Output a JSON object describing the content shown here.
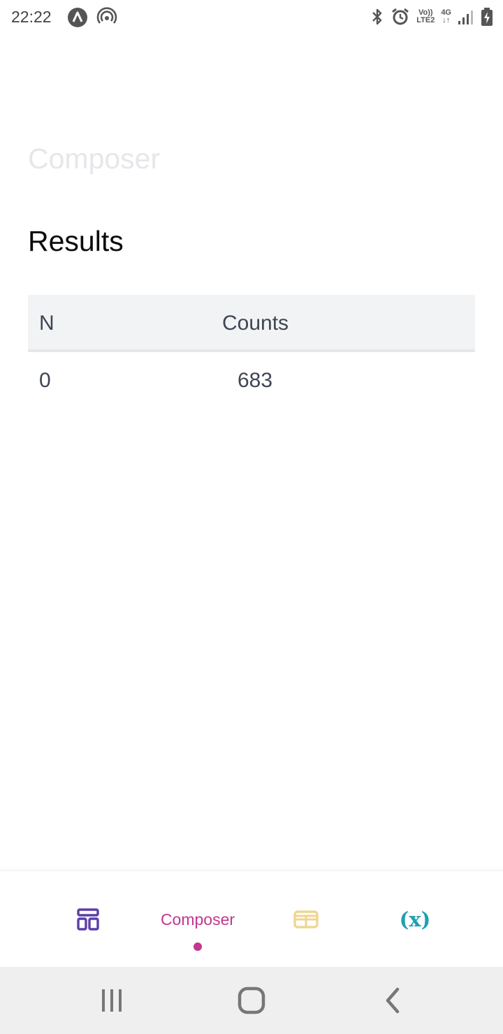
{
  "status_bar": {
    "time": "22:22",
    "volte_line1": "Vo))",
    "volte_line2": "LTE2",
    "network_label": "4G",
    "network_arrows": "↓↑"
  },
  "page": {
    "faded_title": "Composer",
    "section_heading": "Results"
  },
  "results_table": {
    "headers": [
      "N",
      "Counts"
    ],
    "rows": [
      [
        "0",
        "683"
      ]
    ]
  },
  "bottom_nav": {
    "items": [
      {
        "icon": "layout-icon",
        "color": "#5b3fa8"
      },
      {
        "label": "Composer",
        "color": "#c2378f",
        "active": true
      },
      {
        "icon": "table-icon",
        "color": "#eed692"
      },
      {
        "label": "(x)",
        "icon": "variables-icon",
        "color": "#20a0b0"
      }
    ]
  },
  "system_nav": {
    "buttons": [
      "recents-icon",
      "home-icon",
      "back-icon"
    ]
  }
}
